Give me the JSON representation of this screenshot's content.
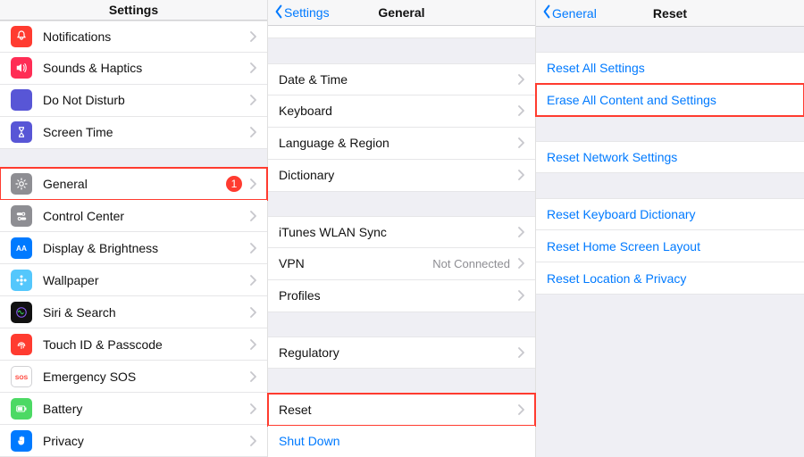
{
  "col1": {
    "title": "Settings",
    "items": [
      {
        "label": "Notifications",
        "icon": "bell",
        "bg": "#ff3b30"
      },
      {
        "label": "Sounds & Haptics",
        "icon": "speaker",
        "bg": "#ff2d55"
      },
      {
        "label": "Do Not Disturb",
        "icon": "moon",
        "bg": "#5856d6"
      },
      {
        "label": "Screen Time",
        "icon": "hourglass",
        "bg": "#5856d6"
      }
    ],
    "items2": [
      {
        "label": "General",
        "icon": "gear",
        "bg": "#8e8e93",
        "badge": "1",
        "highlight": true
      },
      {
        "label": "Control Center",
        "icon": "switches",
        "bg": "#8e8e93"
      },
      {
        "label": "Display & Brightness",
        "icon": "aa",
        "bg": "#007aff"
      },
      {
        "label": "Wallpaper",
        "icon": "flower",
        "bg": "#54c7fc"
      },
      {
        "label": "Siri & Search",
        "icon": "siri",
        "bg": "#111111"
      },
      {
        "label": "Touch ID & Passcode",
        "icon": "fingerprint",
        "bg": "#ff3b30"
      },
      {
        "label": "Emergency SOS",
        "icon": "sos",
        "bg": "#ffffff"
      },
      {
        "label": "Battery",
        "icon": "battery",
        "bg": "#4cd964"
      },
      {
        "label": "Privacy",
        "icon": "hand",
        "bg": "#007aff"
      }
    ]
  },
  "col2": {
    "back": "Settings",
    "title": "General",
    "groupA": [
      {
        "label": "Date & Time"
      },
      {
        "label": "Keyboard"
      },
      {
        "label": "Language & Region"
      },
      {
        "label": "Dictionary"
      }
    ],
    "groupB": [
      {
        "label": "iTunes WLAN Sync"
      },
      {
        "label": "VPN",
        "detail": "Not Connected"
      },
      {
        "label": "Profiles"
      }
    ],
    "groupC": [
      {
        "label": "Regulatory"
      }
    ],
    "groupD": [
      {
        "label": "Reset",
        "highlight": true
      }
    ],
    "shutdown": "Shut Down"
  },
  "col3": {
    "back": "General",
    "title": "Reset",
    "groupA": [
      {
        "label": "Reset All Settings"
      },
      {
        "label": "Erase All Content and Settings",
        "highlight": true
      }
    ],
    "groupB": [
      {
        "label": "Reset Network Settings"
      }
    ],
    "groupC": [
      {
        "label": "Reset Keyboard Dictionary"
      },
      {
        "label": "Reset Home Screen Layout"
      },
      {
        "label": "Reset Location & Privacy"
      }
    ]
  }
}
